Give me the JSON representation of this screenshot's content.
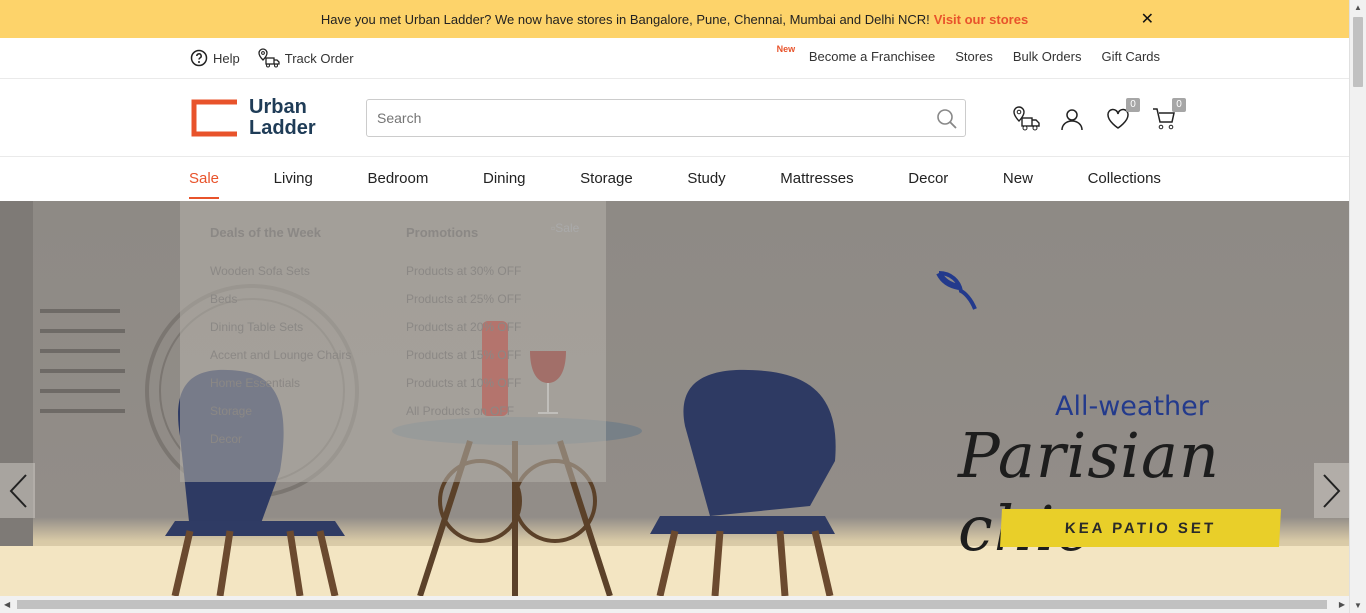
{
  "announcement": {
    "text": "Have you met Urban Ladder? We now have stores in Bangalore, Pune, Chennai, Mumbai and Delhi NCR!",
    "link": "Visit our stores",
    "close": "✕"
  },
  "utility": {
    "help": "Help",
    "track_order": "Track Order",
    "new_tag": "New",
    "franchise": "Become a Franchisee",
    "stores": "Stores",
    "bulk_orders": "Bulk Orders",
    "gift_cards": "Gift Cards"
  },
  "header": {
    "logo_line1": "Urban",
    "logo_line2": "Ladder",
    "search_placeholder": "Search",
    "wishlist_count": "0",
    "cart_count": "0"
  },
  "nav": {
    "items": [
      "Sale",
      "Living",
      "Bedroom",
      "Dining",
      "Storage",
      "Study",
      "Mattresses",
      "Decor",
      "New",
      "Collections"
    ],
    "active": "Sale"
  },
  "mega_menu": {
    "col1_head": "Deals of the Week",
    "col1_links": [
      "Wooden Sofa Sets",
      "Beds",
      "Dining Table Sets",
      "Accent and Lounge Chairs",
      "Home Essentials",
      "Storage",
      "Decor"
    ],
    "col2_head": "Promotions",
    "col2_links": [
      "Products at 30% OFF",
      "Products at 25% OFF",
      "Products at 20% OFF",
      "Products at 15% OFF",
      "Products at 10% OFF",
      "All Products on OFF"
    ],
    "image_alt": "Sale"
  },
  "hero": {
    "title_small": "All-weather",
    "title_large": "Parisian chic",
    "cta": "KEA PATIO SET"
  },
  "colors": {
    "announce_bg": "#fdd36a",
    "accent": "#e8532b",
    "brand_text": "#1f3c57",
    "cta_bg": "#e9cf29"
  }
}
